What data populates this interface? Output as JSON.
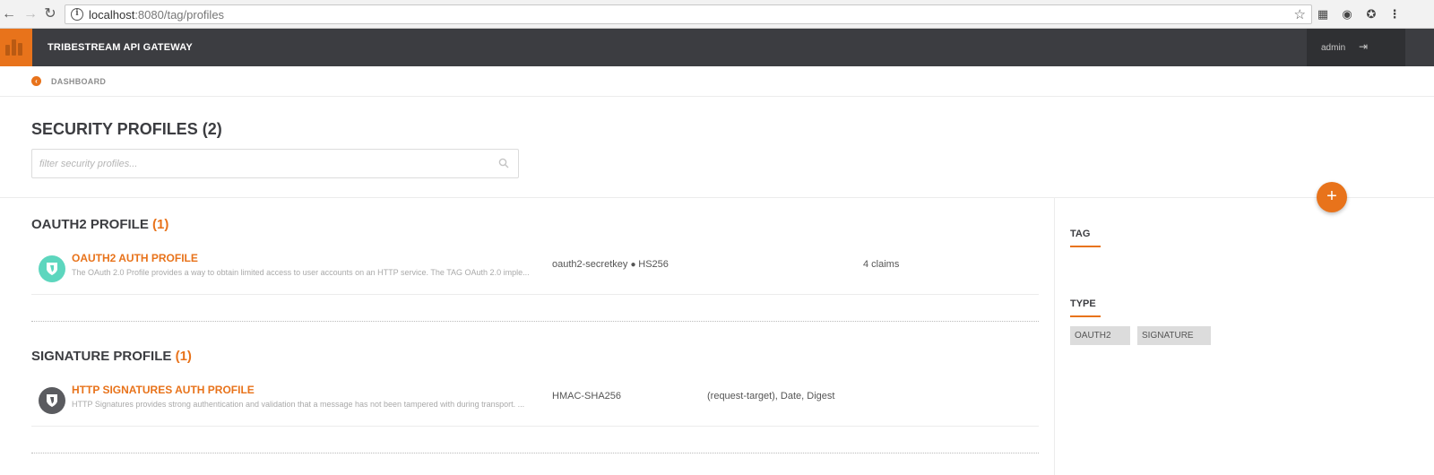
{
  "browser": {
    "url_host": "localhost",
    "url_path": ":8080/tag/profiles"
  },
  "header": {
    "app_title": "TRIBESTREAM API GATEWAY",
    "user": "admin"
  },
  "breadcrumb": {
    "label": "DASHBOARD"
  },
  "page": {
    "title": "SECURITY PROFILES (2)",
    "filter_placeholder": "filter security profiles..."
  },
  "add_button": {
    "label": "+"
  },
  "groups": [
    {
      "title": "OAUTH2 PROFILE",
      "count": "(1)",
      "profiles": [
        {
          "name": "OAUTH2 AUTH PROFILE",
          "description": "The OAuth 2.0 Profile provides a way to obtain limited access to user accounts on an HTTP service. The TAG OAuth 2.0 imple...",
          "key": "oauth2-secretkey",
          "algorithm": "HS256",
          "claims": "4 claims",
          "icon_color": "#5dd6be"
        }
      ]
    },
    {
      "title": "SIGNATURE PROFILE",
      "count": "(1)",
      "profiles": [
        {
          "name": "HTTP SIGNATURES AUTH PROFILE",
          "description": "HTTP Signatures provides strong authentication and validation that a message has not been tampered with during transport. ...",
          "algorithm": "HMAC-SHA256",
          "headers": "(request-target), Date, Digest",
          "icon_color": "#5a5b5f"
        }
      ]
    }
  ],
  "sidebar": {
    "tag_title": "TAG",
    "type_title": "TYPE",
    "type_chips": [
      "OAUTH2",
      "SIGNATURE"
    ]
  },
  "colors": {
    "accent": "#e8731b",
    "header_bg": "#3c3d41"
  }
}
